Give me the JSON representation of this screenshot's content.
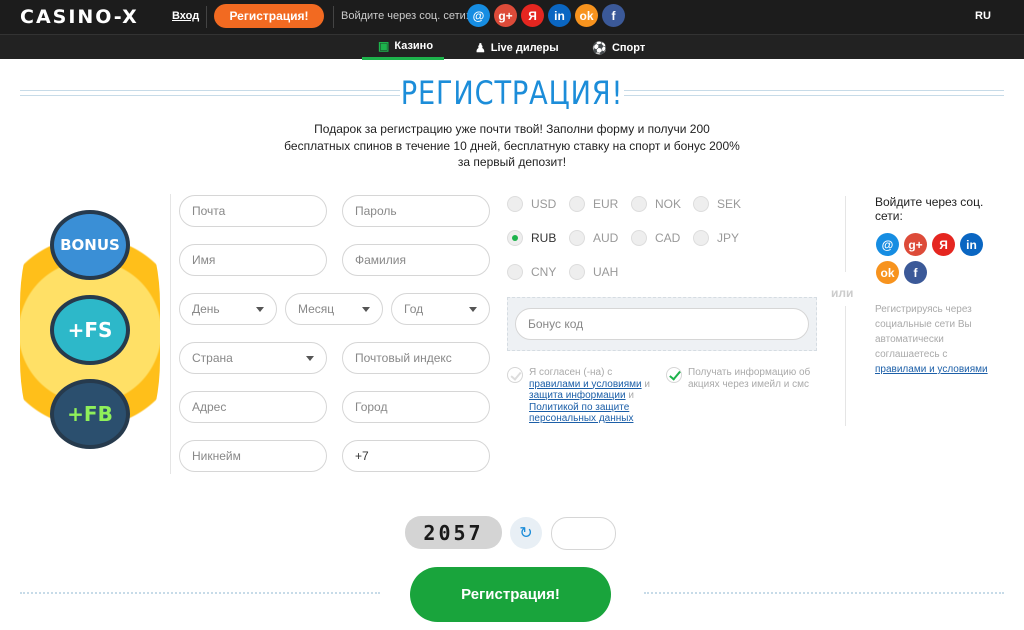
{
  "header": {
    "logo": "CASINO-X",
    "login": "Вход",
    "register_button": "Регистрация!",
    "social_label": "Войдите через соц. сети:",
    "language": "RU"
  },
  "social_networks": [
    {
      "name": "mail-ru",
      "glyph": "@",
      "color": "#168de2"
    },
    {
      "name": "google-plus",
      "glyph": "g+",
      "color": "#dd4b39"
    },
    {
      "name": "yandex",
      "glyph": "Я",
      "color": "#e52620"
    },
    {
      "name": "linkedin",
      "glyph": "in",
      "color": "#0a66c2"
    },
    {
      "name": "odnoklassniki",
      "glyph": "ok",
      "color": "#f7931e"
    },
    {
      "name": "facebook",
      "glyph": "f",
      "color": "#3b5998"
    }
  ],
  "nav": {
    "casino": "Казино",
    "live": "Live дилеры",
    "sport": "Спорт"
  },
  "page": {
    "title": "РЕГИСТРАЦИЯ!",
    "subtitle": "Подарок за регистрацию уже почти твой! Заполни форму и получи 200 бесплатных спинов в течение 10 дней, бесплатную ставку на спорт и бонус 200% за первый депозит!"
  },
  "badges": {
    "bonus": "BONUS",
    "fs": "+FS",
    "fb": "+FB"
  },
  "form": {
    "email": "Почта",
    "password": "Пароль",
    "first_name": "Имя",
    "last_name": "Фамилия",
    "day": "День",
    "month": "Месяц",
    "year": "Год",
    "country": "Страна",
    "zip": "Почтовый индекс",
    "address": "Адрес",
    "city": "Город",
    "nickname": "Никнейм",
    "phone": "+7"
  },
  "currencies": {
    "usd": "USD",
    "eur": "EUR",
    "nok": "NOK",
    "sek": "SEK",
    "rub": "RUB",
    "aud": "AUD",
    "cad": "CAD",
    "jpy": "JPY",
    "cny": "CNY",
    "uah": "UAH",
    "selected": "RUB"
  },
  "promo": {
    "placeholder": "Бонус код"
  },
  "or_label": "или",
  "agreement": {
    "prefix": "Я согласен (-на) с",
    "rules_link": "правилами и условиями",
    "and1": " и",
    "protection_link": "защита информации",
    "and2": " и",
    "policy_link": "Политикой по защите персональных данных"
  },
  "newsletter": "Получать информацию об акциях через имейл и смс",
  "side": {
    "title": "Войдите через соц. сети:",
    "note": "Регистрируясь через социальные сети Вы автоматически соглашаетесь с",
    "note_link": "правилами и условиями"
  },
  "captcha": {
    "code": "2057"
  },
  "submit_button": "Регистрация!"
}
